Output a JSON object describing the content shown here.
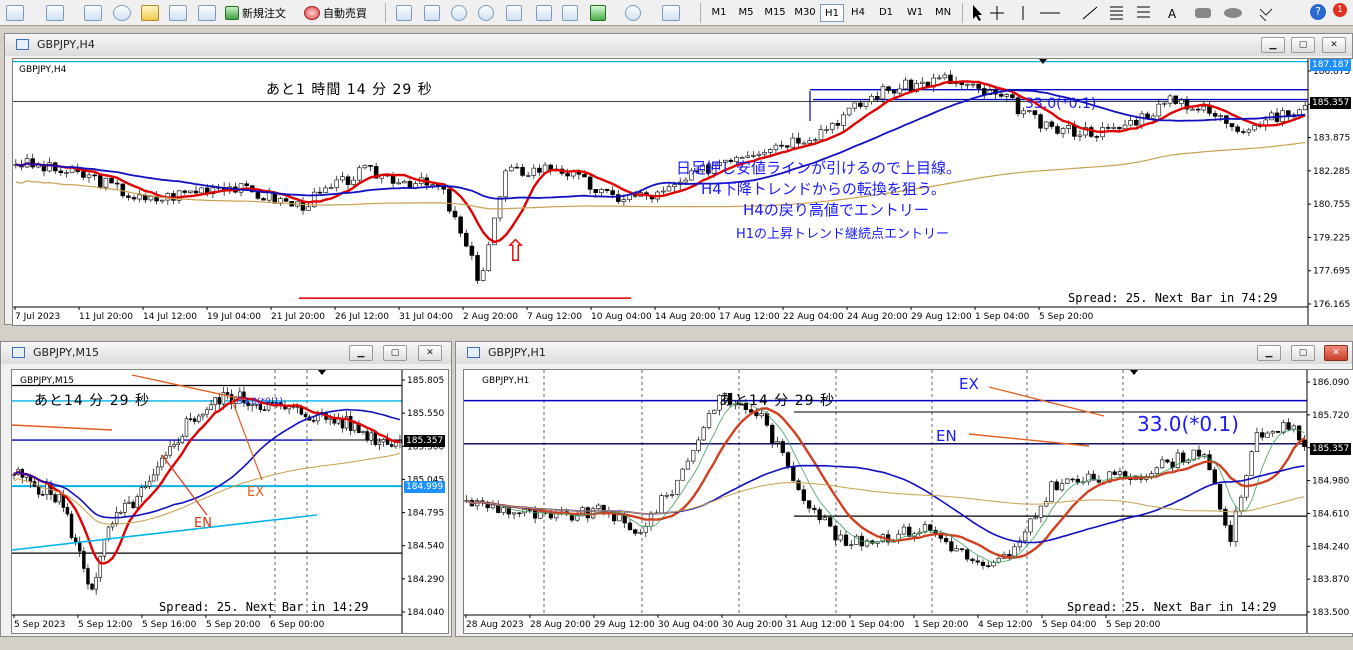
{
  "toolbar": {
    "new_order": "新規注文",
    "auto_trade": "自動売買",
    "timeframes": [
      "M1",
      "M5",
      "M15",
      "M30",
      "H1",
      "H4",
      "D1",
      "W1",
      "MN"
    ],
    "active_timeframe": "H1",
    "text_tool": "A"
  },
  "colors": {
    "red_ma": "#e00000",
    "blue_ma": "#1010c0",
    "gold_ma": "#c8a050",
    "note_blue": "#1a1aff",
    "cyan_line": "#00b4e6"
  },
  "win_h4": {
    "title": "GBPJPY,H4",
    "symbol": "GBPJPY,H4",
    "countdown": "あと1 時間 14 分 29 秒",
    "spread": "Spread: 25. Next Bar in 74:29",
    "price_labels": [
      "187.187",
      "186.875",
      "185.357",
      "183.875",
      "182.285",
      "180.755",
      "179.225",
      "177.695",
      "176.165"
    ],
    "current_price": "185.357",
    "level_label": "33.0(*0.1)",
    "notes": [
      "日足押し安値ラインが引けるので上目線。",
      "H4下降トレンドからの転換を狙う。",
      "H4の戻り高値でエントリー",
      "H1の上昇トレンド継続点エントリー"
    ],
    "arrow": "⇧",
    "x_labels": [
      "7 Jul 2023",
      "11 Jul 20:00",
      "14 Jul 12:00",
      "19 Jul 04:00",
      "21 Jul 20:00",
      "26 Jul 12:00",
      "31 Jul 04:00",
      "2 Aug 20:00",
      "7 Aug 12:00",
      "10 Aug 04:00",
      "14 Aug 20:00",
      "17 Aug 12:00",
      "22 Aug 04:00",
      "24 Aug 20:00",
      "29 Aug 12:00",
      "1 Sep 04:00",
      "5 Sep 20:00"
    ]
  },
  "win_m15": {
    "title": "GBPJPY,M15",
    "symbol": "GBPJPY,M15",
    "countdown": "あと14 分 29 秒",
    "spread": "Spread: 25. Next Bar in 14:29",
    "price_labels": [
      "185.805",
      "185.550",
      "185.300",
      "185.045",
      "184.795",
      "184.540",
      "184.290",
      "184.040"
    ],
    "current_price": "185.357",
    "cyan_price": "184.999",
    "level_label": "33.0(*0.1)",
    "label_ex": "EX",
    "label_en": "EN",
    "x_labels": [
      "5 Sep 2023",
      "5 Sep 12:00",
      "5 Sep 16:00",
      "5 Sep 20:00",
      "6 Sep 00:00"
    ]
  },
  "win_h1": {
    "title": "GBPJPY,H1",
    "symbol": "GBPJPY,H1",
    "countdown": "あと14 分 29 秒",
    "spread": "Spread: 25. Next Bar in 14:29",
    "price_labels": [
      "186.090",
      "185.720",
      "185.357",
      "184.980",
      "184.610",
      "184.240",
      "183.870",
      "183.500"
    ],
    "current_price": "185.357",
    "level_label": "33.0(*0.1)",
    "label_ex": "EX",
    "label_en": "EN",
    "x_labels": [
      "28 Aug 2023",
      "28 Aug 20:00",
      "29 Aug 12:00",
      "30 Aug 04:00",
      "30 Aug 20:00",
      "31 Aug 12:00",
      "1 Sep 04:00",
      "1 Sep 20:00",
      "4 Sep 12:00",
      "5 Sep 04:00",
      "5 Sep 20:00"
    ]
  }
}
